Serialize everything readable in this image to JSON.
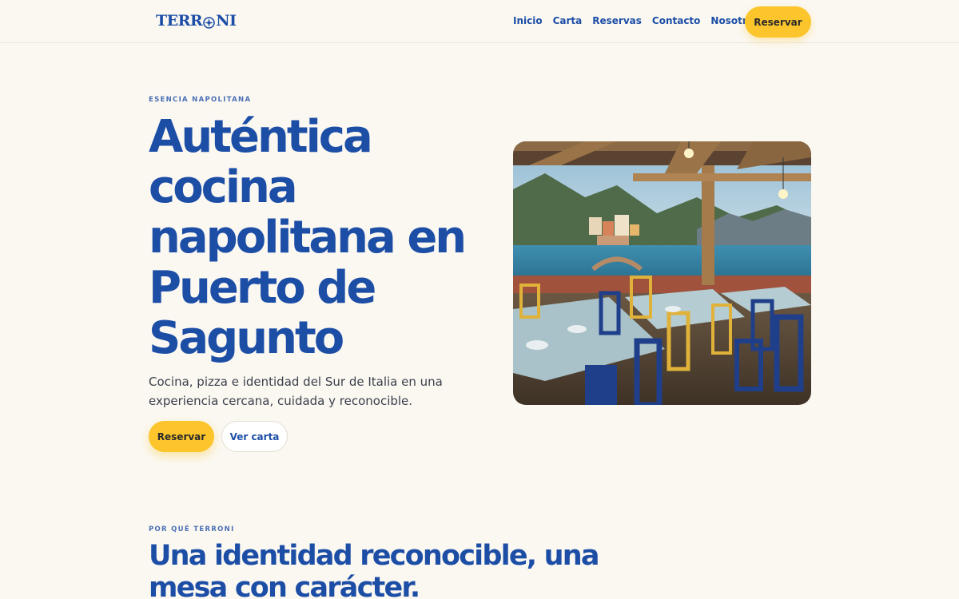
{
  "header": {
    "logo_text_left": "TERR",
    "logo_text_right": "NI",
    "nav": [
      "Inicio",
      "Carta",
      "Reservas",
      "Contacto",
      "Nosotros"
    ],
    "cta_label": "Reservar"
  },
  "hero": {
    "eyebrow": "ESENCIA NAPOLITANA",
    "title": "Auténtica cocina napolitana en Puerto de Sagunto",
    "subtitle": "Cocina, pizza e identidad del Sur de Italia en una experiencia cercana, cuidada y reconocible.",
    "primary_label": "Reservar",
    "secondary_label": "Ver carta"
  },
  "section": {
    "eyebrow": "POR QUÉ TERRONI",
    "title": "Una identidad reconocible, una mesa con carácter."
  },
  "colors": {
    "brand_blue": "#1c4ea6",
    "accent_yellow": "#fbc52b",
    "background": "#fbf8f2"
  }
}
